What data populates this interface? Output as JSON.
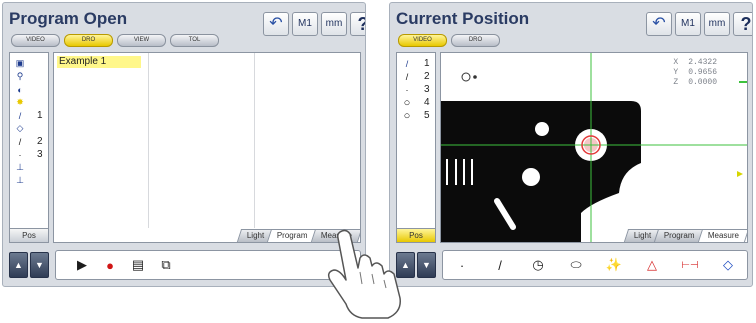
{
  "left": {
    "title": "Program Open",
    "modes": [
      "VIDEO",
      "DRO",
      "VIEW",
      "TOL"
    ],
    "active_mode": "DRO",
    "top_buttons": {
      "undo": "↶",
      "m1": "M1",
      "mm": "mm",
      "help": "?"
    },
    "sidebar": [
      {
        "icon": "▣",
        "num": ""
      },
      {
        "icon": "⚲",
        "num": ""
      },
      {
        "icon": "◐",
        "num": ""
      },
      {
        "icon": "✸",
        "num": ""
      },
      {
        "icon": "/",
        "num": "1"
      },
      {
        "icon": "◇",
        "num": ""
      },
      {
        "icon": "/",
        "num": "2"
      },
      {
        "icon": "·",
        "num": "3"
      },
      {
        "icon": "⊥",
        "num": ""
      },
      {
        "icon": "⊥",
        "num": ""
      }
    ],
    "pos_label": "Pos",
    "program_item": "Example 1",
    "tabs": [
      "Light",
      "Program",
      "Measure"
    ],
    "active_tab": "Program",
    "tools": [
      "▶",
      "●",
      "▤",
      "⧉"
    ]
  },
  "right": {
    "title": "Current Position",
    "modes": [
      "VIDEO",
      "DRO"
    ],
    "active_mode": "VIDEO",
    "top_buttons": {
      "undo": "↶",
      "m1": "M1",
      "mm": "mm",
      "help": "?"
    },
    "sidebar": [
      {
        "icon": "/",
        "num": "1"
      },
      {
        "icon": "/",
        "num": "2"
      },
      {
        "icon": "·",
        "num": "3"
      },
      {
        "icon": "○",
        "num": "4"
      },
      {
        "icon": "○",
        "num": "5"
      }
    ],
    "pos_label": "Pos",
    "readout": [
      {
        "axis": "X",
        "value": "2.4322"
      },
      {
        "axis": "Y",
        "value": "0.9656"
      },
      {
        "axis": "Z",
        "value": "0.0000"
      }
    ],
    "tabs": [
      "Light",
      "Program",
      "Measure"
    ],
    "active_tab": "Measure",
    "tools": [
      "·",
      "/",
      "◷",
      "⬭",
      "✨",
      "△",
      "⊢⊣",
      "◇"
    ]
  }
}
